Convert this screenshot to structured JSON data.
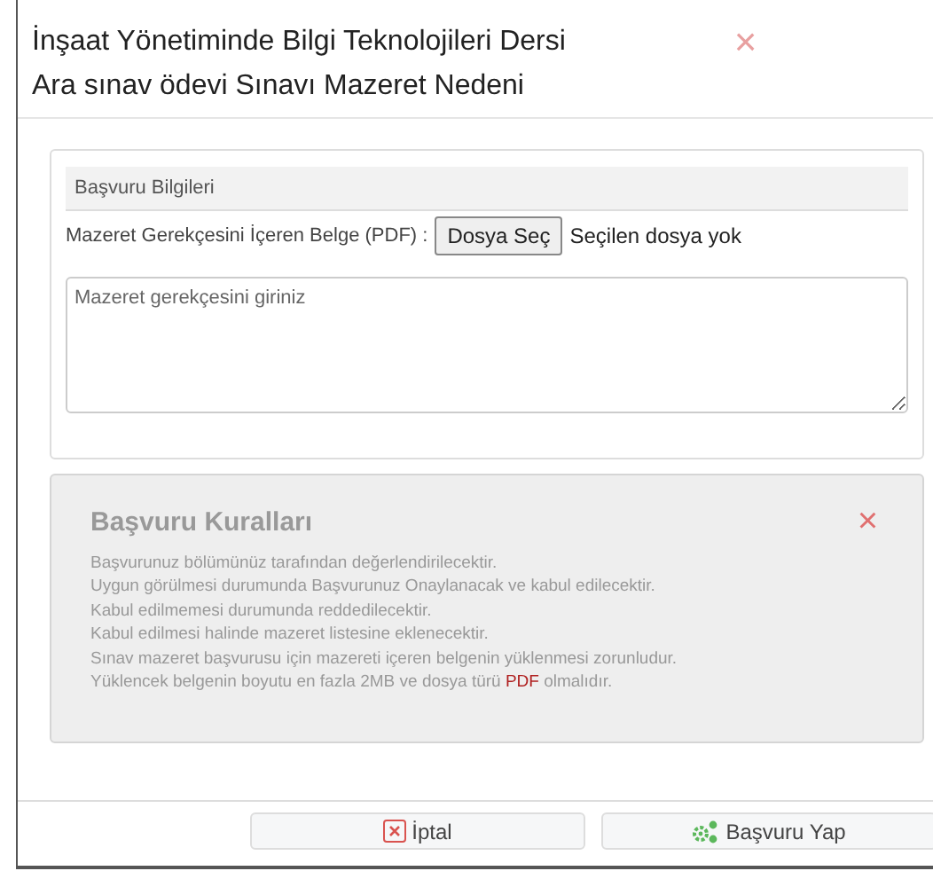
{
  "dialog": {
    "title_lines": [
      "İnşaat Yönetiminde Bilgi Teknolojileri Dersi",
      "Ara sınav ödevi Sınavı Mazeret Nedeni"
    ],
    "close": "×"
  },
  "form": {
    "heading": "Başvuru Bilgileri",
    "file_label": "Mazeret Gerekçesini İçeren Belge (PDF) :",
    "file_button": "Dosya Seç",
    "file_status": "Seçilen dosya yok",
    "reason_placeholder": "Mazeret gerekçesini giriniz"
  },
  "rules": {
    "title": "Başvuru Kuralları",
    "close": "×",
    "lines": [
      {
        "text": "Başvurunuz bölümünüz tarafından değerlendirilecektir."
      },
      {
        "text": "Uygun görülmesi durumunda Başvurunuz Onaylanacak ve kabul edilecektir."
      },
      {
        "text": "Kabul edilmemesi durumunda reddedilecektir."
      },
      {
        "text": "Kabul edilmesi halinde mazeret listesine eklenecektir."
      },
      {
        "text": "Sınav mazeret başvurusu için mazereti içeren belgenin yüklenmesi zorunludur."
      },
      {
        "text": "Yüklencek belgenin boyutu en fazla 2MB ve dosya türü ",
        "highlight": "PDF",
        "after": " olmalıdır."
      }
    ]
  },
  "buttons": [
    {
      "kind": "cancel",
      "label": "İptal"
    },
    {
      "kind": "submit",
      "label": "Başvuru Yap"
    }
  ]
}
